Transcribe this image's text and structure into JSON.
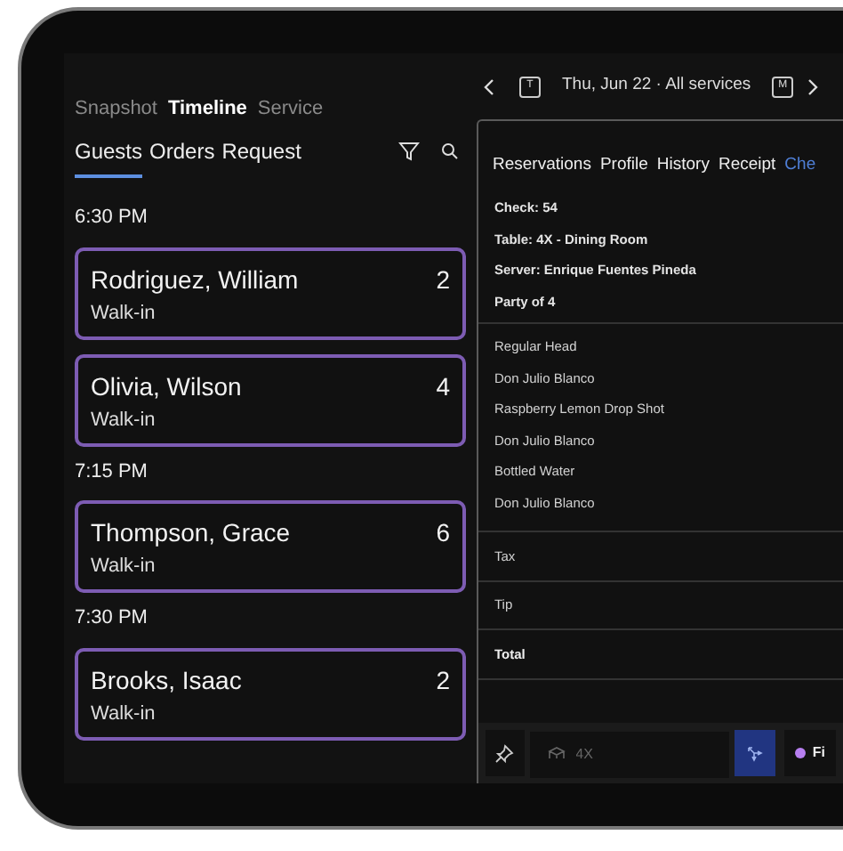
{
  "view_tabs": [
    {
      "label": "Snapshot",
      "selected": false
    },
    {
      "label": "Timeline",
      "selected": true
    },
    {
      "label": "Service",
      "selected": false
    }
  ],
  "list_tabs": [
    {
      "label": "Guests",
      "selected": true
    },
    {
      "label": "Orders",
      "selected": false
    },
    {
      "label": "Request",
      "selected": false
    }
  ],
  "timeline": [
    {
      "time": "6:30 PM",
      "guests": [
        {
          "name": "Rodriguez, William",
          "party": "2",
          "source": "Walk-in"
        },
        {
          "name": "Olivia, Wilson",
          "party": "4",
          "source": "Walk-in"
        }
      ]
    },
    {
      "time": "7:15 PM",
      "guests": [
        {
          "name": "Thompson, Grace",
          "party": "6",
          "source": "Walk-in"
        }
      ]
    },
    {
      "time": "7:30 PM",
      "guests": [
        {
          "name": "Brooks, Isaac",
          "party": "2",
          "source": "Walk-in"
        }
      ]
    }
  ],
  "date_nav": {
    "today_letter": "T",
    "date": "Thu, Jun 22 · All services",
    "month_letter": "M"
  },
  "detail_tabs": [
    {
      "label": "Reservations",
      "selected": false
    },
    {
      "label": "Profile",
      "selected": false
    },
    {
      "label": "History",
      "selected": false
    },
    {
      "label": "Receipt",
      "selected": false
    },
    {
      "label": "Che",
      "selected": true
    }
  ],
  "check_info": [
    "Check: 54",
    "Table: 4X - Dining Room",
    "Server: Enrique Fuentes Pineda",
    "Party of 4"
  ],
  "items": [
    "Regular Head",
    "Don Julio Blanco",
    "Raspberry Lemon Drop Shot",
    "Don Julio Blanco",
    "Bottled Water",
    "Don Julio Blanco"
  ],
  "summary": [
    {
      "label": "Tax",
      "emphasis": false
    },
    {
      "label": "Tip",
      "emphasis": false
    },
    {
      "label": "Total",
      "emphasis": true
    }
  ],
  "bottom_bar": {
    "table_field": {
      "placeholder": "4X"
    },
    "status_button": {
      "label": "Fi",
      "color": "#b77ff0"
    }
  }
}
